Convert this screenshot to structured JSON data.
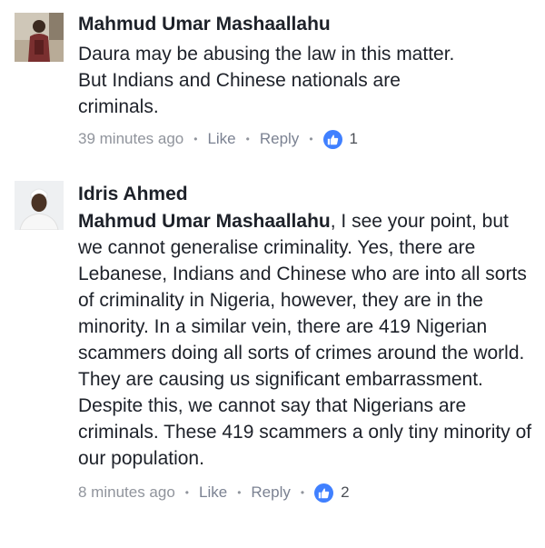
{
  "comments": [
    {
      "author": "Mahmud Umar Mashaallahu",
      "text": "Daura may be abusing the law in this matter. But Indians and Chinese nationals are criminals.",
      "time": "39 minutes ago",
      "like_label": "Like",
      "reply_label": "Reply",
      "reaction_count": "1",
      "reaction_icon": "thumbs-up-icon",
      "reaction_color": "#4080ff"
    },
    {
      "author": "Idris Ahmed",
      "mention": "Mahmud Umar Mashaallahu",
      "text": ", I see your point, but we cannot generalise criminality. Yes, there are Lebanese, Indians and Chinese who are into all sorts of criminality in Nigeria, however, they are in the minority. In a similar vein, there are 419 Nigerian scammers doing all sorts of crimes around the world. They are causing us significant embarrassment. Despite this, we cannot say that Nigerians are criminals. These 419 scammers a only tiny minority of our population.",
      "time": "8 minutes ago",
      "like_label": "Like",
      "reply_label": "Reply",
      "reaction_count": "2",
      "reaction_icon": "thumbs-up-icon",
      "reaction_color": "#4080ff"
    }
  ],
  "separator_glyph": "•"
}
